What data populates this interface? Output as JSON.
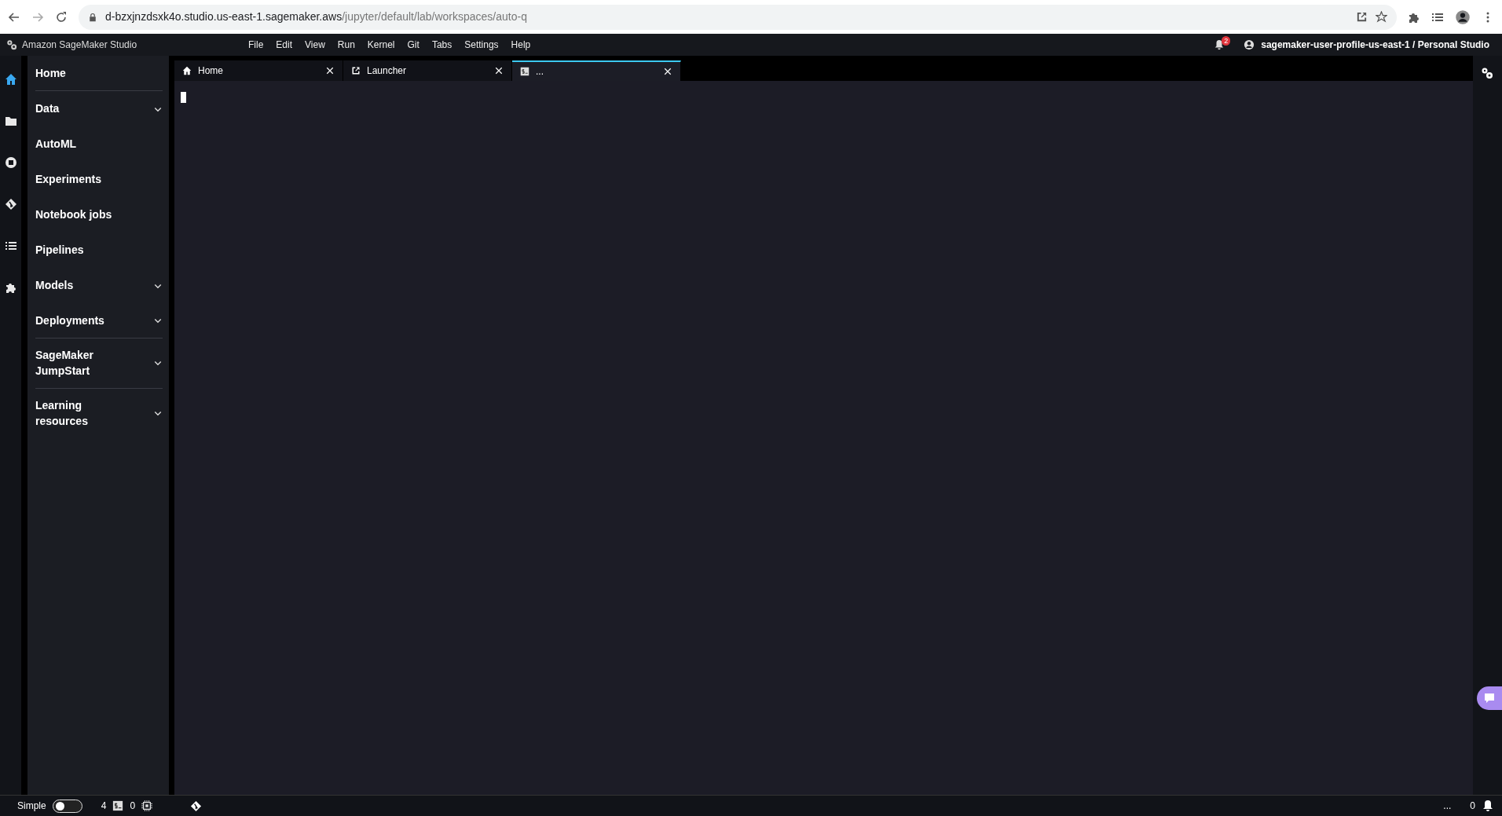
{
  "browser": {
    "url_host": "d-bzxjnzdsxk4o.studio.us-east-1.sagemaker.aws",
    "url_path": "/jupyter/default/lab/workspaces/auto-q"
  },
  "app": {
    "title": "Amazon SageMaker Studio",
    "menus": [
      "File",
      "Edit",
      "View",
      "Run",
      "Kernel",
      "Git",
      "Tabs",
      "Settings",
      "Help"
    ],
    "notification_count": "2",
    "user": "sagemaker-user-profile-us-east-1 / Personal Studio"
  },
  "rail": [
    {
      "selected": true
    },
    {
      "selected": false
    },
    {
      "selected": false
    },
    {
      "selected": false
    },
    {
      "selected": false
    },
    {
      "selected": false
    }
  ],
  "sidebar": {
    "items": [
      {
        "label": "Home",
        "kind": "link",
        "divider_after": true
      },
      {
        "label": "Data",
        "kind": "group",
        "divider_after": false
      },
      {
        "label": "AutoML",
        "kind": "link",
        "divider_after": false
      },
      {
        "label": "Experiments",
        "kind": "link",
        "divider_after": false
      },
      {
        "label": "Notebook jobs",
        "kind": "link",
        "divider_after": false
      },
      {
        "label": "Pipelines",
        "kind": "link",
        "divider_after": false
      },
      {
        "label": "Models",
        "kind": "group",
        "divider_after": false
      },
      {
        "label": "Deployments",
        "kind": "group",
        "divider_after": true
      },
      {
        "label": "SageMaker JumpStart",
        "kind": "group",
        "divider_after": true
      },
      {
        "label": "Learning resources",
        "kind": "group",
        "divider_after": false
      }
    ]
  },
  "tabs": [
    {
      "label": "Home",
      "selected": false
    },
    {
      "label": "Launcher",
      "selected": false
    },
    {
      "label": "...",
      "selected": true
    }
  ],
  "status_bar": {
    "mode_label": "Simple",
    "simple_mode_on": false,
    "terminals": "4",
    "kernels": "0",
    "right_text": "...",
    "notifications": "0"
  }
}
